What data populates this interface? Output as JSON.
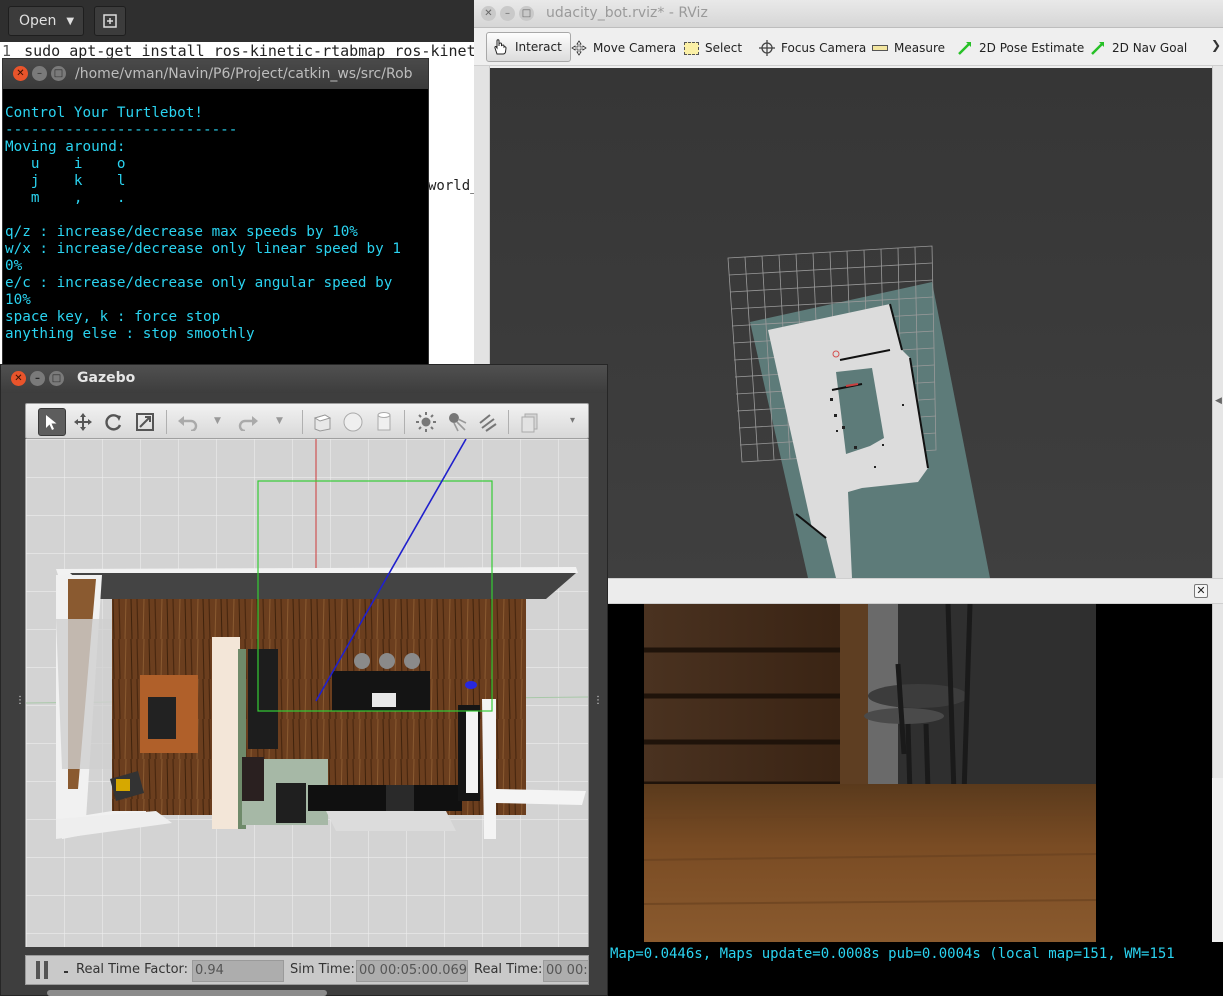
{
  "editor": {
    "open_label": "Open",
    "line_number": "1",
    "line_text": "sudo apt-get install ros-kinetic-rtabmap ros-kinet",
    "partial_text": "world_"
  },
  "terminal": {
    "title": "/home/vman/Navin/P6/Project/catkin_ws/src/Rob",
    "body": "Control Your Turtlebot!\n---------------------------\nMoving around:\n   u    i    o\n   j    k    l\n   m    ,    .\n\nq/z : increase/decrease max speeds by 10%\nw/x : increase/decrease only linear speed by 1\n0%\ne/c : increase/decrease only angular speed by\n10%\nspace key, k : force stop\nanything else : stop smoothly"
  },
  "rviz": {
    "title": "udacity_bot.rviz* - RViz",
    "tools": [
      {
        "label": "Interact",
        "icon": "hand-icon"
      },
      {
        "label": "Move Camera",
        "icon": "move-camera-icon"
      },
      {
        "label": "Select",
        "icon": "select-icon"
      },
      {
        "label": "Focus Camera",
        "icon": "focus-camera-icon"
      },
      {
        "label": "Measure",
        "icon": "ruler-icon"
      },
      {
        "label": "2D Pose Estimate",
        "icon": "green-arrow-icon"
      },
      {
        "label": "2D Nav Goal",
        "icon": "green-arrow-icon"
      }
    ],
    "status": "Map=0.0446s, Maps update=0.0008s pub=0.0004s (local map=151, WM=151",
    "accent_green": "#27c127"
  },
  "gazebo": {
    "title": "Gazebo",
    "real_time_factor_label": "Real Time Factor:",
    "real_time_factor": "0.94",
    "sim_time_label": "Sim Time:",
    "sim_time": "00 00:05:00.069",
    "real_time_label": "Real Time:",
    "real_time": "00 00:"
  }
}
